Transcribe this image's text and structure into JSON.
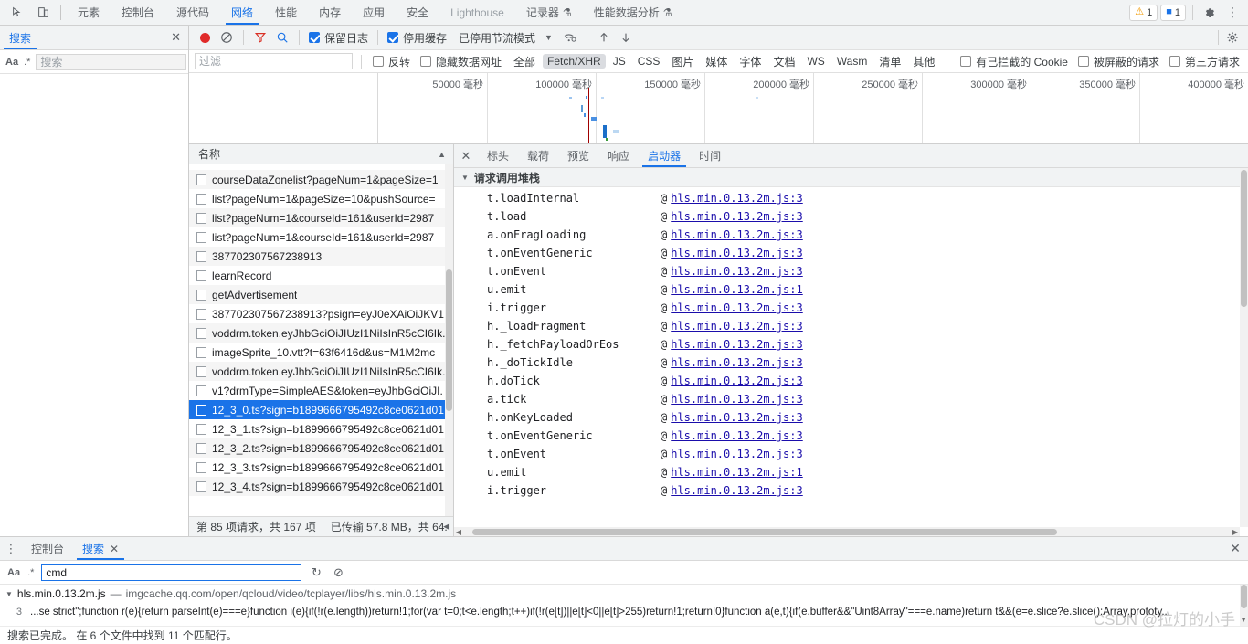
{
  "main_tabs": {
    "inspect_icon": "inspect-element-icon",
    "device_icon": "device-toolbar-icon",
    "items": [
      {
        "label": "元素",
        "selected": false,
        "dim": false,
        "flask": false
      },
      {
        "label": "控制台",
        "selected": false,
        "dim": false,
        "flask": false
      },
      {
        "label": "源代码",
        "selected": false,
        "dim": false,
        "flask": false
      },
      {
        "label": "网络",
        "selected": true,
        "dim": false,
        "flask": false
      },
      {
        "label": "性能",
        "selected": false,
        "dim": false,
        "flask": false
      },
      {
        "label": "内存",
        "selected": false,
        "dim": false,
        "flask": false
      },
      {
        "label": "应用",
        "selected": false,
        "dim": false,
        "flask": false
      },
      {
        "label": "安全",
        "selected": false,
        "dim": false,
        "flask": false
      },
      {
        "label": "Lighthouse",
        "selected": false,
        "dim": true,
        "flask": false
      },
      {
        "label": "记录器",
        "selected": false,
        "dim": false,
        "flask": true
      },
      {
        "label": "性能数据分析",
        "selected": false,
        "dim": false,
        "flask": true
      }
    ],
    "warning_count": "1",
    "message_count": "1",
    "settings_icon": "gear-icon",
    "more_icon": "kebab-menu-icon"
  },
  "sidebar": {
    "tab_label": "搜索",
    "close_icon": "close-icon",
    "match_case_label": "Aa",
    "regex_label": ".*",
    "search_placeholder": "搜索",
    "search_value": "",
    "refresh_icon": "refresh-icon",
    "clear_icon": "clear-icon"
  },
  "network_toolbar": {
    "record_icon": "record-button",
    "clear_icon": "clear-icon",
    "filter_icon": "filter-funnel-icon",
    "search_icon": "search-icon",
    "preserve_log": {
      "label": "保留日志",
      "checked": true
    },
    "disable_cache": {
      "label": "停用缓存",
      "checked": true
    },
    "throttle_label": "已停用节流模式",
    "throttle_caret": "chevron-down-icon",
    "wifi_icon": "network-conditions-icon",
    "import_icon": "import-har-icon",
    "export_icon": "export-har-icon",
    "settings_icon": "gear-icon"
  },
  "filter_bar": {
    "placeholder": "过滤",
    "value": "",
    "invert": {
      "label": "反转",
      "checked": false
    },
    "hide_data_urls": {
      "label": "隐藏数据网址",
      "checked": false
    },
    "types": [
      {
        "label": "全部",
        "selected": false
      },
      {
        "label": "Fetch/XHR",
        "selected": true
      },
      {
        "label": "JS",
        "selected": false
      },
      {
        "label": "CSS",
        "selected": false
      },
      {
        "label": "图片",
        "selected": false
      },
      {
        "label": "媒体",
        "selected": false
      },
      {
        "label": "字体",
        "selected": false
      },
      {
        "label": "文档",
        "selected": false
      },
      {
        "label": "WS",
        "selected": false
      },
      {
        "label": "Wasm",
        "selected": false
      },
      {
        "label": "清单",
        "selected": false
      },
      {
        "label": "其他",
        "selected": false
      }
    ],
    "blocked_cookies": {
      "label": "有已拦截的 Cookie",
      "checked": false
    },
    "blocked_requests": {
      "label": "被屏蔽的请求",
      "checked": false
    },
    "third_party": {
      "label": "第三方请求",
      "checked": false
    }
  },
  "overview": {
    "ticks": [
      {
        "label": "50000 毫秒",
        "pct": 12.5
      },
      {
        "label": "100000 毫秒",
        "pct": 25.0
      },
      {
        "label": "150000 毫秒",
        "pct": 37.5
      },
      {
        "label": "200000 毫秒",
        "pct": 50.0
      },
      {
        "label": "250000 毫秒",
        "pct": 62.5
      },
      {
        "label": "300000 毫秒",
        "pct": 75.0
      },
      {
        "label": "350000 毫秒",
        "pct": 87.5
      },
      {
        "label": "400000 毫秒",
        "pct": 100.0
      }
    ],
    "marker_pct": 24.2
  },
  "request_list": {
    "column_header": "名称",
    "sort_icon": "sort-ascending-icon",
    "rows": [
      {
        "name": "courseDataZonelist?pageNum=1&pageSize=1",
        "selected": false
      },
      {
        "name": "list?pageNum=1&pageSize=10&pushSource=",
        "selected": false
      },
      {
        "name": "list?pageNum=1&courseId=161&userId=2987",
        "selected": false
      },
      {
        "name": "list?pageNum=1&courseId=161&userId=2987",
        "selected": false
      },
      {
        "name": "387702307567238913",
        "selected": false
      },
      {
        "name": "learnRecord",
        "selected": false
      },
      {
        "name": "getAdvertisement",
        "selected": false
      },
      {
        "name": "387702307567238913?psign=eyJ0eXAiOiJKV1",
        "selected": false
      },
      {
        "name": "voddrm.token.eyJhbGciOiJIUzI1NiIsInR5cCI6Ik.",
        "selected": false
      },
      {
        "name": "imageSprite_10.vtt?t=63f6416d&us=M1M2mc",
        "selected": false
      },
      {
        "name": "voddrm.token.eyJhbGciOiJIUzI1NiIsInR5cCI6Ik.",
        "selected": false
      },
      {
        "name": "v1?drmType=SimpleAES&token=eyJhbGciOiJI.",
        "selected": false
      },
      {
        "name": "12_3_0.ts?sign=b1899666795492c8ce0621d01",
        "selected": true
      },
      {
        "name": "12_3_1.ts?sign=b1899666795492c8ce0621d01",
        "selected": false
      },
      {
        "name": "12_3_2.ts?sign=b1899666795492c8ce0621d01",
        "selected": false
      },
      {
        "name": "12_3_3.ts?sign=b1899666795492c8ce0621d01",
        "selected": false
      },
      {
        "name": "12_3_4.ts?sign=b1899666795492c8ce0621d01",
        "selected": false
      }
    ],
    "status_requests": "第 85 项请求，共 167 项",
    "status_transfer": "已传输 57.8 MB，共 64."
  },
  "detail": {
    "close_icon": "close-icon",
    "tabs": [
      {
        "label": "标头",
        "selected": false
      },
      {
        "label": "载荷",
        "selected": false
      },
      {
        "label": "预览",
        "selected": false
      },
      {
        "label": "响应",
        "selected": false
      },
      {
        "label": "启动器",
        "selected": true
      },
      {
        "label": "时间",
        "selected": false
      }
    ],
    "section_title": "请求调用堆栈",
    "section_triangle": "triangle-down-icon",
    "stack": [
      {
        "fn": "t.loadInternal",
        "at": "@",
        "link": "hls.min.0.13.2m.js:3"
      },
      {
        "fn": "t.load",
        "at": "@",
        "link": "hls.min.0.13.2m.js:3"
      },
      {
        "fn": "a.onFragLoading",
        "at": "@",
        "link": "hls.min.0.13.2m.js:3"
      },
      {
        "fn": "t.onEventGeneric",
        "at": "@",
        "link": "hls.min.0.13.2m.js:3"
      },
      {
        "fn": "t.onEvent",
        "at": "@",
        "link": "hls.min.0.13.2m.js:3"
      },
      {
        "fn": "u.emit",
        "at": "@",
        "link": "hls.min.0.13.2m.js:1"
      },
      {
        "fn": "i.trigger",
        "at": "@",
        "link": "hls.min.0.13.2m.js:3"
      },
      {
        "fn": "h._loadFragment",
        "at": "@",
        "link": "hls.min.0.13.2m.js:3"
      },
      {
        "fn": "h._fetchPayloadOrEos",
        "at": "@",
        "link": "hls.min.0.13.2m.js:3"
      },
      {
        "fn": "h._doTickIdle",
        "at": "@",
        "link": "hls.min.0.13.2m.js:3"
      },
      {
        "fn": "h.doTick",
        "at": "@",
        "link": "hls.min.0.13.2m.js:3"
      },
      {
        "fn": "a.tick",
        "at": "@",
        "link": "hls.min.0.13.2m.js:3"
      },
      {
        "fn": "h.onKeyLoaded",
        "at": "@",
        "link": "hls.min.0.13.2m.js:3"
      },
      {
        "fn": "t.onEventGeneric",
        "at": "@",
        "link": "hls.min.0.13.2m.js:3"
      },
      {
        "fn": "t.onEvent",
        "at": "@",
        "link": "hls.min.0.13.2m.js:3"
      },
      {
        "fn": "u.emit",
        "at": "@",
        "link": "hls.min.0.13.2m.js:1"
      },
      {
        "fn": "i.trigger",
        "at": "@",
        "link": "hls.min.0.13.2m.js:3"
      }
    ]
  },
  "drawer": {
    "kebab_icon": "kebab-menu-icon",
    "tabs": [
      {
        "label": "控制台",
        "selected": false,
        "closable": false
      },
      {
        "label": "搜索",
        "selected": true,
        "closable": true
      }
    ],
    "close_icon": "close-icon",
    "match_case_label": "Aa",
    "regex_label": ".*",
    "search_value": "cmd",
    "refresh_icon": "refresh-icon",
    "clear_icon": "clear-icon",
    "result_triangle": "triangle-down-icon",
    "result_file": "hls.min.0.13.2m.js",
    "result_dash": "—",
    "result_url": "imgcache.qq.com/open/qcloud/video/tcplayer/libs/hls.min.0.13.2m.js",
    "result_line_no": "3",
    "result_code": "...se strict\";function r(e){return parseInt(e)===e}function i(e){if(!r(e.length))return!1;for(var t=0;t<e.length;t++)if(!r(e[t])||e[t]<0||e[t]>255)return!1;return!0}function a(e,t){if(e.buffer&&\"Uint8Array\"===e.name)return t&&(e=e.slice?e.slice():Array.prototy...",
    "footer_status": "搜索已完成。 在 6 个文件中找到 11 个匹配行。"
  },
  "watermark": "CSDN @拉灯的小手",
  "colors": {
    "accent": "#1a73e8",
    "record": "#e02a2a",
    "link": "#1a0dab",
    "warn": "#f29900",
    "toolbar_bg": "#f1f3f4"
  }
}
